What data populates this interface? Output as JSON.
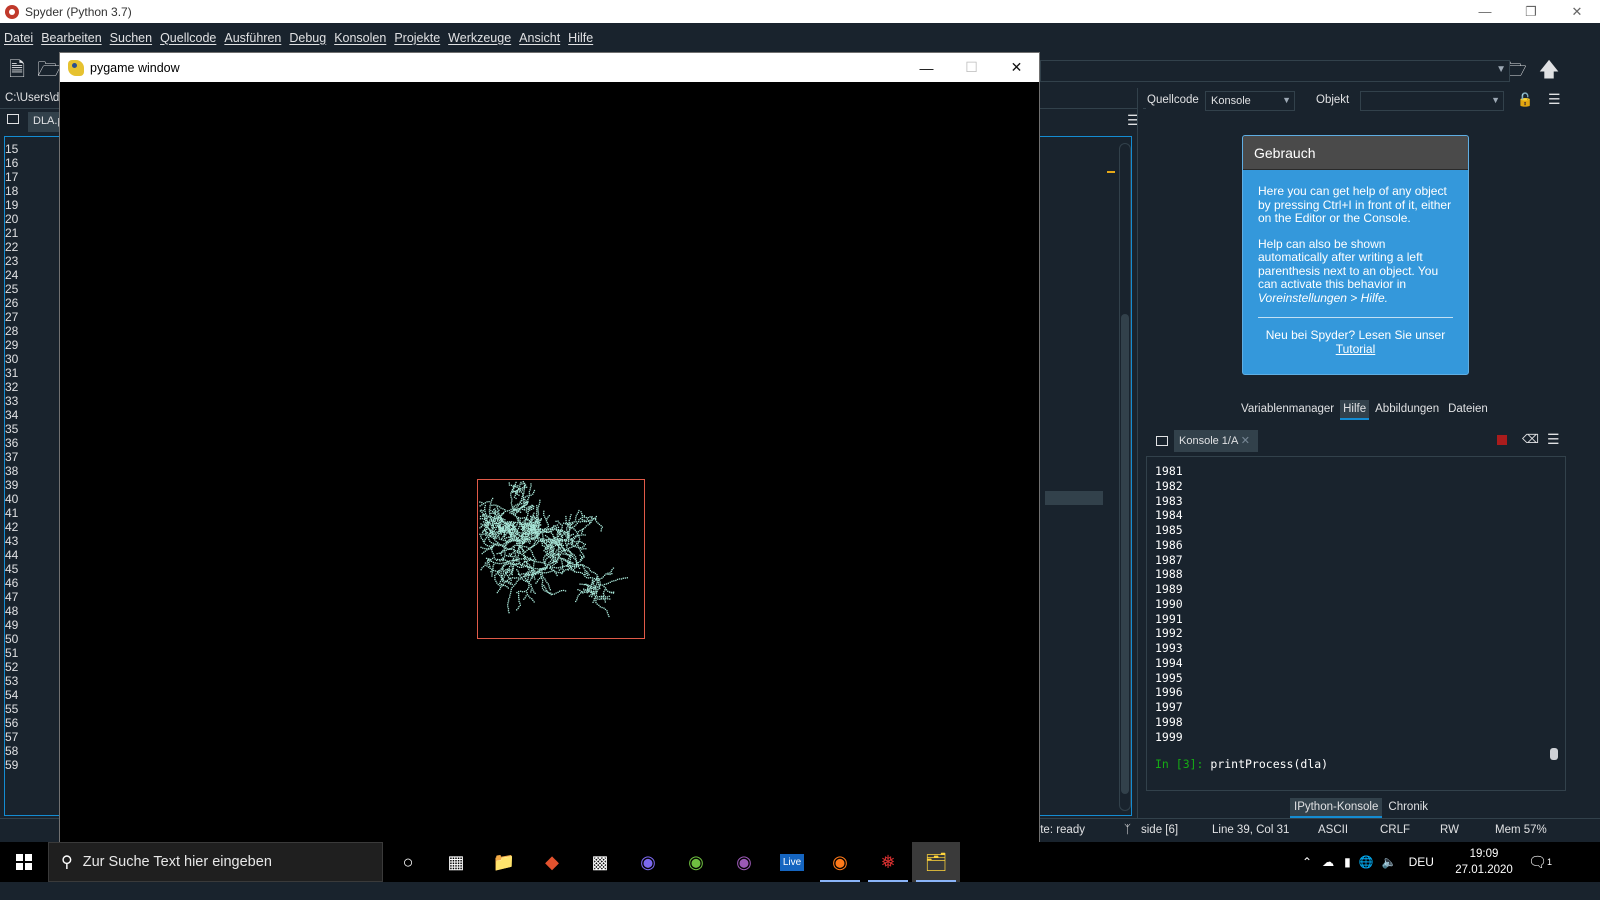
{
  "window": {
    "title": "Spyder (Python 3.7)"
  },
  "menu": [
    "Datei",
    "Bearbeiten",
    "Suchen",
    "Quellcode",
    "Ausführen",
    "Debug",
    "Konsolen",
    "Projekte",
    "Werkzeuge",
    "Ansicht",
    "Hilfe"
  ],
  "left_path": "C:\\Users\\d",
  "editor": {
    "tab_label": "DLA.p",
    "line_numbers": [
      "15",
      "16",
      "17",
      "18",
      "19",
      "20",
      "21",
      "22",
      "23",
      "24",
      "25",
      "26",
      "27",
      "28",
      "29",
      "30",
      "31",
      "32",
      "33",
      "34",
      "35",
      "36",
      "37",
      "38",
      "39",
      "40",
      "41",
      "42",
      "43",
      "44",
      "45",
      "46",
      "47",
      "48",
      "49",
      "50",
      "51",
      "52",
      "53",
      "54",
      "55",
      "56",
      "57",
      "58",
      "59"
    ],
    "current_line": "39"
  },
  "help_pane": {
    "source_label": "Quellcode",
    "source_value": "Konsole",
    "object_label": "Objekt",
    "object_value": "",
    "card_title": "Gebrauch",
    "para1": "Here you can get help of any object by pressing Ctrl+I in front of it, either on the Editor or the Console.",
    "para2_text": "Help can also be shown automatically after writing a left parenthesis next to an object. You can activate this behavior in",
    "para2_link": "Voreinstellungen > Hilfe.",
    "footer_text": "Neu bei Spyder? Lesen Sie unser",
    "footer_link": "Tutorial",
    "tabs": [
      "Variablenmanager",
      "Hilfe",
      "Abbildungen",
      "Dateien"
    ],
    "active_tab": "Hilfe"
  },
  "console": {
    "tab_label": "Konsole 1/A",
    "output_lines": [
      "1981",
      "1982",
      "1983",
      "1984",
      "1985",
      "1986",
      "1987",
      "1988",
      "1989",
      "1990",
      "1991",
      "1992",
      "1993",
      "1994",
      "1995",
      "1996",
      "1997",
      "1998",
      "1999"
    ],
    "prompt": "In [3]:",
    "command": "printProcess(dla)",
    "bottom_tabs": [
      "IPython-Konsole",
      "Chronik"
    ]
  },
  "status": {
    "kite": "Kite: ready",
    "git": "side [6]",
    "position": "Line 39, Col 31",
    "encoding": "ASCII",
    "eol": "CRLF",
    "mode": "RW",
    "mem": "Mem 57%"
  },
  "pygame": {
    "title": "pygame window",
    "simulation": "DLA cluster",
    "frame_color": "#e05a48",
    "particle_color": "#a8e6d8"
  },
  "taskbar": {
    "search_placeholder": "Zur Suche Text hier eingeben",
    "apps": [
      "cortana-icon",
      "task-view-icon",
      "file-explorer-icon",
      "git-icon",
      "terminal-icon",
      "eclipse-icon",
      "android-studio-icon",
      "app-icon",
      "live-icon",
      "firefox-icon",
      "spyder-icon",
      "python-icon"
    ],
    "live_label": "Live",
    "language": "DEU",
    "time": "19:09",
    "date": "27.01.2020",
    "notifications": "1"
  }
}
